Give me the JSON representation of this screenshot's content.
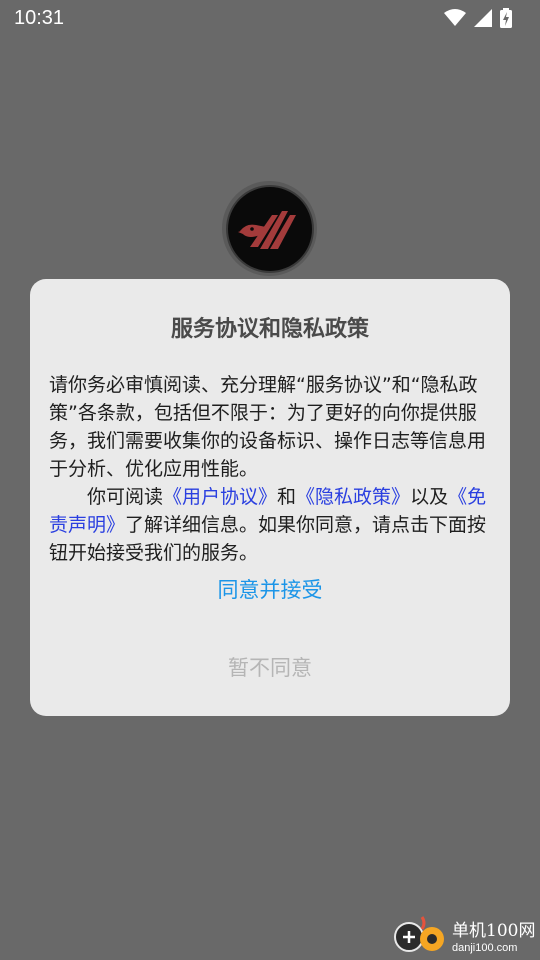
{
  "status_bar": {
    "time": "10:31",
    "icons": [
      "wifi-icon",
      "signal-icon",
      "battery-charging-icon"
    ]
  },
  "logo": {
    "icon": "bird-logo-icon"
  },
  "dialog": {
    "title": "服务协议和隐私政策",
    "paragraph1": "请你务必审慎阅读、充分理解“服务协议”和“隐私政策”各条款，包括但不限于：为了更好的向你提供服务，我们需要收集你的设备标识、操作日志等信息用于分析、优化应用性能。",
    "p2_lead": "你可阅读",
    "link_user_agreement": "《用户协议》",
    "p2_and": "和",
    "link_privacy_policy": "《隐私政策》",
    "p2_also": "以及",
    "link_disclaimer": "《免责声明》",
    "p2_tail": "了解详细信息。如果你同意，请点击下面按钮开始接受我们的服务。",
    "accept_label": "同意并接受",
    "decline_label": "暂不同意"
  },
  "colors": {
    "backdrop": "#696969",
    "dialog_bg": "#eaeaea",
    "link": "#2a3fe0",
    "accept": "#1b95e8",
    "decline": "#b5b5b5"
  },
  "watermark": {
    "title": "单机100网",
    "url": "danji100.com"
  }
}
